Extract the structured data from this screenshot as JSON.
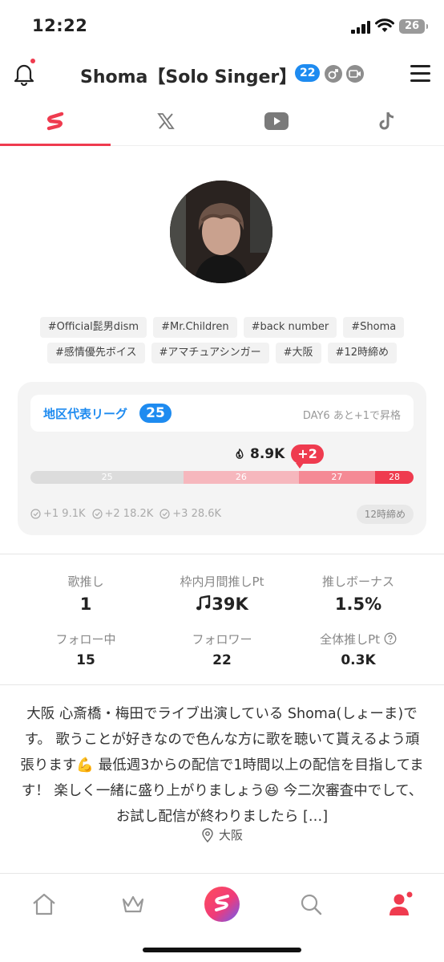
{
  "status_bar": {
    "time": "12:22",
    "battery": "26"
  },
  "header": {
    "title": "Shoma【Solo Singer】",
    "level": "22",
    "icons": [
      "bell-icon",
      "male-gender-icon",
      "video-icon",
      "menu-icon"
    ]
  },
  "sns_tabs": [
    {
      "name": "app",
      "icon": "app-logo-icon",
      "active": true
    },
    {
      "name": "x",
      "icon": "x-icon",
      "active": false
    },
    {
      "name": "youtube",
      "icon": "youtube-icon",
      "active": false
    },
    {
      "name": "tiktok",
      "icon": "tiktok-icon",
      "active": false
    }
  ],
  "tags": {
    "row1": [
      "#Official髭男dism",
      "#Mr.Children",
      "#back number",
      "#Shoma"
    ],
    "row2": [
      "#感情優先ボイス",
      "#アマチュアシンガー",
      "#大阪",
      "#12時締め"
    ]
  },
  "league": {
    "title": "地区代表リーグ",
    "rank": "25",
    "status": "DAY6 あと+1で昇格",
    "points": "8.9K",
    "change": "+2",
    "segments": [
      {
        "label": "25",
        "share": 0.4,
        "color": "#dcdcdc"
      },
      {
        "label": "26",
        "share": 0.3,
        "color": "#f6b7bd"
      },
      {
        "label": "27",
        "share": 0.2,
        "color": "#f58a95"
      },
      {
        "label": "28",
        "share": 0.1,
        "color": "#ef3b4f"
      }
    ],
    "progress_fraction": 0.7,
    "milestones": [
      "+1 9.1K",
      "+2 18.2K",
      "+3 28.6K"
    ],
    "deadline": "12時締め"
  },
  "stats": {
    "uta_oshi_label": "歌推し",
    "uta_oshi_value": "1",
    "monthly_pt_label": "枠内月間推しPt",
    "monthly_pt_value": "39K",
    "bonus_label": "推しボーナス",
    "bonus_value": "1.5%",
    "following_label": "フォロー中",
    "following_value": "15",
    "followers_label": "フォロワー",
    "followers_value": "22",
    "total_pt_label": "全体推しPt",
    "total_pt_value": "0.3K"
  },
  "bio": {
    "text": "大阪 心斎橋・梅田でライブ出演している Shoma(しょーま)です。 歌うことが好きなので色んな方に歌を聴いて貰えるよう頑張ります💪 最低週3からの配信で1時間以上の配信を目指してます！ 楽しく一緒に盛り上がりましょう😆 今二次審査中でして、お試し配信が終わりましたら […]",
    "location": "大阪"
  },
  "bottom_nav": [
    "home-icon",
    "crown-icon",
    "app-logo-icon",
    "search-icon",
    "profile-icon"
  ],
  "colors": {
    "accent": "#ef3b4f",
    "blue": "#1e8bf0"
  }
}
